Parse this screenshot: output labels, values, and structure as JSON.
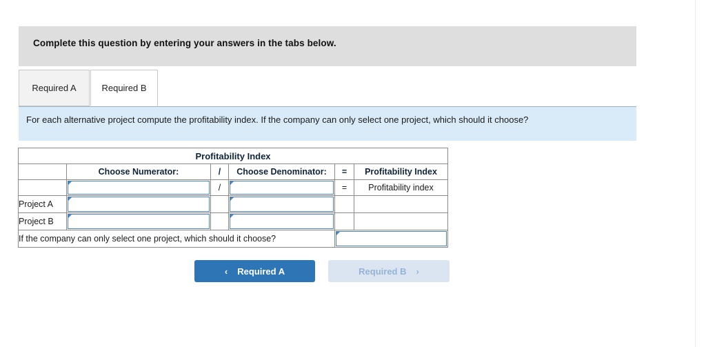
{
  "banner": {
    "instruction": "Complete this question by entering your answers in the tabs below."
  },
  "tabs": [
    {
      "label": "Required A",
      "active": false
    },
    {
      "label": "Required B",
      "active": true
    }
  ],
  "question": {
    "prompt": "For each alternative project compute the profitability index. If the company can only select one project, which should it choose?"
  },
  "worksheet": {
    "title": "Profitability Index",
    "columns": [
      "",
      "Choose Numerator:",
      "/",
      "Choose Denominator:",
      "=",
      "Profitability Index"
    ],
    "formula_row": {
      "label": "",
      "numerator": "",
      "operator": "/",
      "denominator": "",
      "equals": "=",
      "result": "Profitability index"
    },
    "rows": [
      {
        "label": "Project A",
        "numerator": "",
        "operator": "",
        "denominator": "",
        "equals": "",
        "result": ""
      },
      {
        "label": "Project B",
        "numerator": "",
        "operator": "",
        "denominator": "",
        "equals": "",
        "result": ""
      }
    ],
    "answer_row": {
      "prompt": "If the company can only select one project, which should it choose?",
      "value": ""
    }
  },
  "nav": {
    "prev_label": "Required A",
    "prev_chevron": "‹",
    "next_label": "Required B",
    "next_chevron": "›"
  },
  "colors": {
    "header_blue": "#74a9e0",
    "question_blue": "#d9ebf9",
    "banner_grey": "#dedede",
    "input_border": "#4f81bd",
    "result_yellow": "#ffffa8",
    "primary_button": "#2e75b6",
    "disabled_button": "#dbe5f1"
  }
}
